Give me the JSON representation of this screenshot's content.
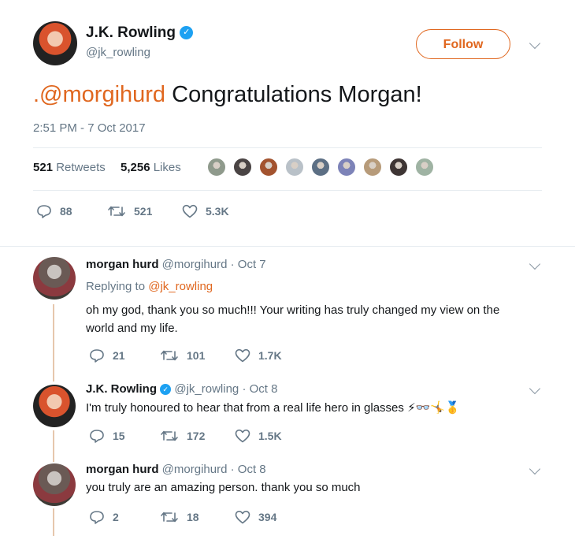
{
  "main_tweet": {
    "author_name": "J.K. Rowling",
    "handle": "@jk_rowling",
    "follow_label": "Follow",
    "mention": ".@morgihurd",
    "text": " Congratulations Morgan!",
    "timestamp": "2:51 PM - 7 Oct 2017",
    "retweets_count": "521",
    "retweets_label": "Retweets",
    "likes_count": "5,256",
    "likes_label": "Likes",
    "actions": {
      "replies": "88",
      "retweets": "521",
      "likes": "5.3K"
    }
  },
  "likers": [
    "#8f9a8c",
    "#4a4444",
    "#a3532f",
    "#b9c1c8",
    "#5c6f84",
    "#7d83b8",
    "#b79b7a",
    "#3e3534",
    "#9fb3a3"
  ],
  "replies": [
    {
      "name": "morgan hurd",
      "handle": "@morgihurd",
      "date": "· Oct 7",
      "replying_prefix": "Replying to ",
      "replying_to": "@jk_rowling",
      "text_line1": "oh my god, thank you so much!!! Your writing has truly changed my view on the",
      "text_line2": "world and my life.",
      "actions": {
        "replies": "21",
        "retweets": "101",
        "likes": "1.7K"
      }
    },
    {
      "name": "J.K. Rowling",
      "handle": "@jk_rowling",
      "date": "· Oct 8",
      "text": "I'm truly honoured to hear that from a real life hero in glasses",
      "emoji": "⚡👓🤸🥇",
      "actions": {
        "replies": "15",
        "retweets": "172",
        "likes": "1.5K"
      }
    },
    {
      "name": "morgan hurd",
      "handle": "@morgihurd",
      "date": "· Oct 8",
      "text": "you truly are an amazing person. thank you so much",
      "actions": {
        "replies": "2",
        "retweets": "18",
        "likes": "394"
      }
    }
  ],
  "colors": {
    "accent": "#e0671f",
    "verified": "#1da1f2",
    "muted": "#657786"
  }
}
